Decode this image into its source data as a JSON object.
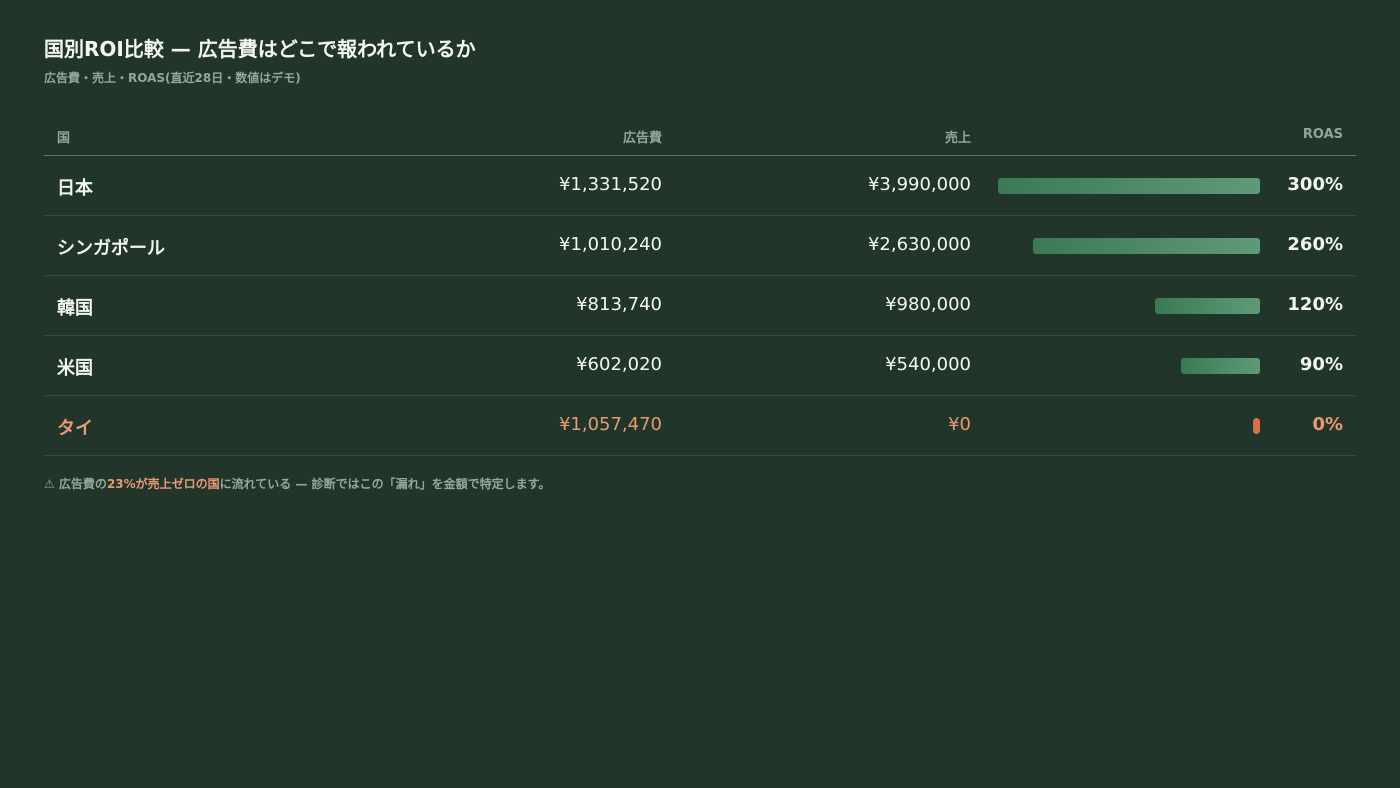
{
  "header": {
    "title": "国別ROI比較 — 広告費はどこで報われているか",
    "subtitle": "広告費・売上・ROAS(直近28日・数値はデモ)"
  },
  "columns": {
    "country": "国",
    "spend": "広告費",
    "sales": "売上",
    "roas": "ROAS"
  },
  "chart_data": {
    "type": "table",
    "categories": [
      "日本",
      "シンガポール",
      "韓国",
      "米国",
      "タイ"
    ],
    "rows": [
      {
        "country": "日本",
        "spend": "¥1,331,520",
        "sales": "¥3,990,000",
        "roas_label": "300%",
        "roas": 300
      },
      {
        "country": "シンガポール",
        "spend": "¥1,010,240",
        "sales": "¥2,630,000",
        "roas_label": "260%",
        "roas": 260
      },
      {
        "country": "韓国",
        "spend": "¥813,740",
        "sales": "¥980,000",
        "roas_label": "120%",
        "roas": 120
      },
      {
        "country": "米国",
        "spend": "¥602,020",
        "sales": "¥540,000",
        "roas_label": "90%",
        "roas": 90
      },
      {
        "country": "タイ",
        "spend": "¥1,057,470",
        "sales": "¥0",
        "roas_label": "0%",
        "roas": 0
      }
    ],
    "roas_max": 300,
    "highlight_color": "#e89a72",
    "bar_color": "#5f9a77"
  },
  "note": {
    "prefix": "⚠ 広告費の",
    "highlight": "23%が売上ゼロの国",
    "suffix": "に流れている — 診断ではこの「漏れ」を金額で特定します。"
  }
}
